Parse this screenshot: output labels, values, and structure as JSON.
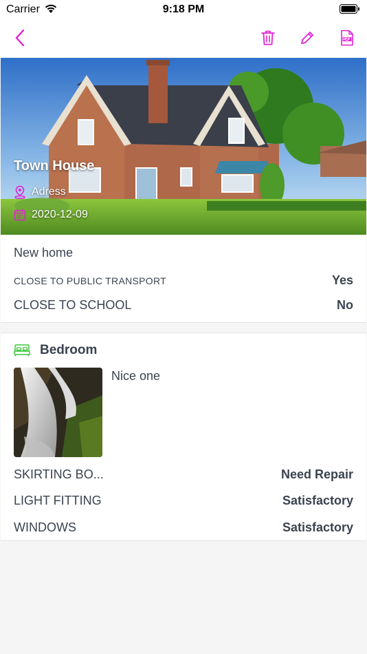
{
  "status_bar": {
    "carrier": "Carrier",
    "time": "9:18 PM"
  },
  "nav": {
    "accent_color": "#e020d6",
    "icons": [
      "back-chevron-icon",
      "trash-icon",
      "pencil-icon",
      "pdf-icon"
    ]
  },
  "property": {
    "title": "Town House",
    "address": "Adress",
    "date": "2020-12-09",
    "description": "New home",
    "attributes": [
      {
        "label": "CLOSE TO PUBLIC TRANSPORT",
        "value": "Yes"
      },
      {
        "label": "CLOSE TO SCHOOL",
        "value": "No"
      }
    ]
  },
  "room": {
    "name": "Bedroom",
    "icon": "bed-icon",
    "icon_color": "#3cc83c",
    "note": "Nice one",
    "items": [
      {
        "name": "SKIRTING BO...",
        "status": "Need Repair"
      },
      {
        "name": "LIGHT FITTING",
        "status": "Satisfactory"
      },
      {
        "name": "WINDOWS",
        "status": "Satisfactory"
      }
    ]
  }
}
